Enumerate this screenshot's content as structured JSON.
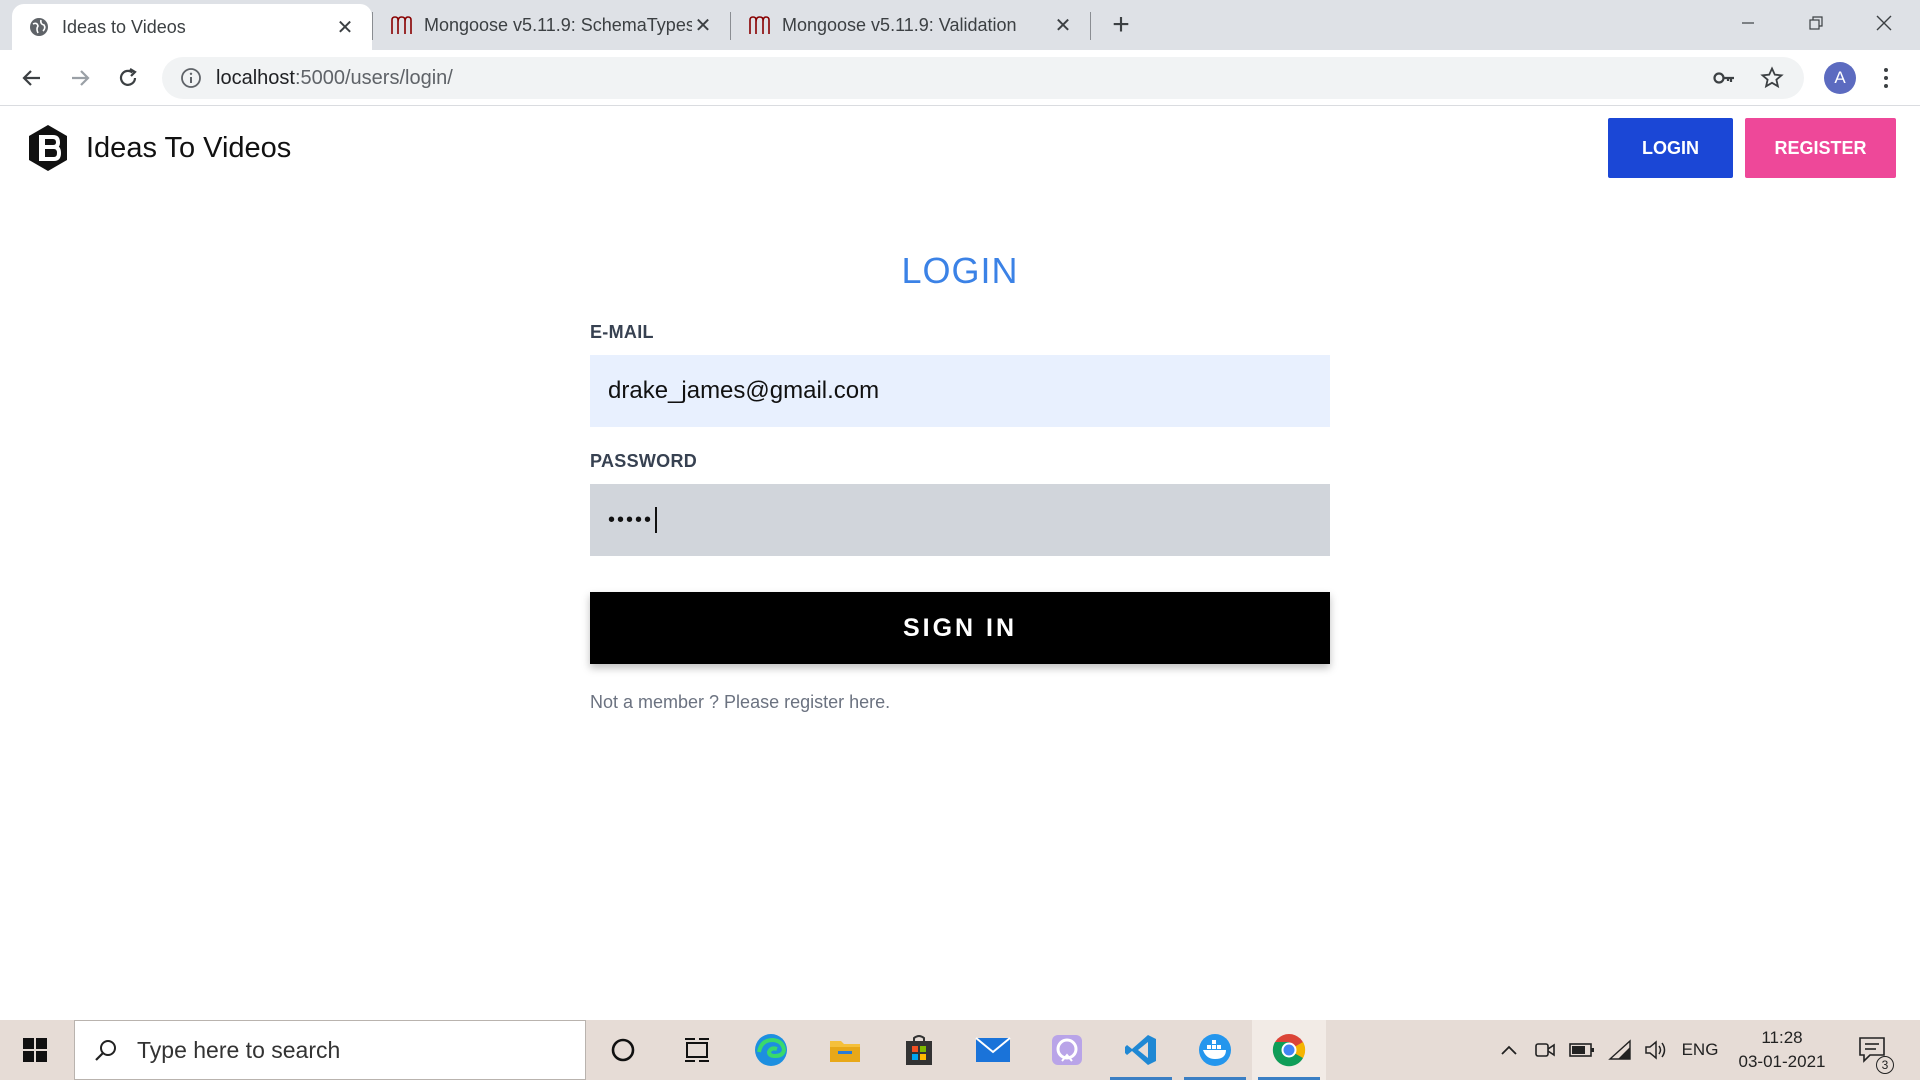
{
  "browser": {
    "tabs": [
      {
        "label": "Ideas to Videos",
        "active": true
      },
      {
        "label": "Mongoose v5.11.9: SchemaTypes",
        "active": false
      },
      {
        "label": "Mongoose v5.11.9: Validation",
        "active": false
      }
    ],
    "url_host": "localhost",
    "url_path": ":5000/users/login/",
    "profile_initial": "A"
  },
  "site": {
    "brand": "Ideas To Videos",
    "nav_login": "LOGIN",
    "nav_register": "REGISTER"
  },
  "form": {
    "title": "LOGIN",
    "email_label": "E-MAIL",
    "email_value": "drake_james@gmail.com",
    "password_label": "PASSWORD",
    "password_value": "•••••",
    "submit_label": "SIGN IN",
    "register_hint": "Not a member ? Please register here."
  },
  "taskbar": {
    "search_placeholder": "Type here to search",
    "language": "ENG",
    "time": "11:28",
    "date": "03-01-2021",
    "notification_count": "3"
  },
  "colors": {
    "accent_blue": "#1b47d6",
    "accent_pink": "#ee4899",
    "title_blue": "#3b82e6"
  }
}
